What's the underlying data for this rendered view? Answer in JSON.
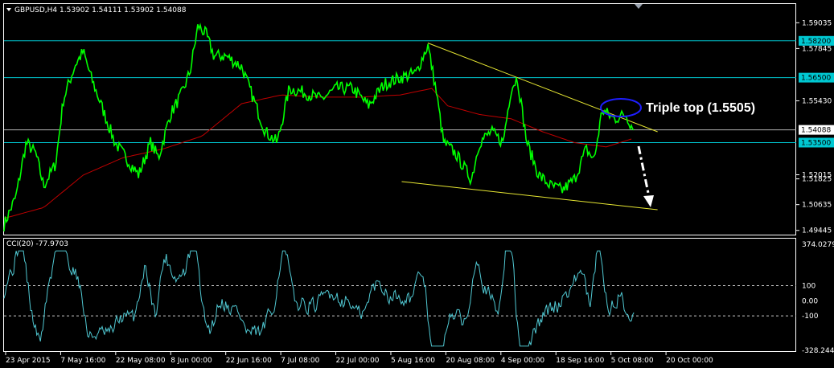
{
  "header": {
    "symbol_line": "GBPUSD,H4  1.53902 1.54111 1.53902 1.54088",
    "indicator_line": "CCI(20) -77.9703"
  },
  "colors": {
    "background": "#000000",
    "frame": "#ffffff",
    "price_line": "#00ff00",
    "moving_average": "#c00000",
    "levels": "#00c8d2",
    "trendlines": "#e6e632",
    "cci_line": "#50c8d2",
    "triple_top_marker": "#1e1eff",
    "forecast_arrow": "#ffffff"
  },
  "price_axis": {
    "labels": [
      "1.59035",
      "1.57845",
      "1.55430",
      "1.52015",
      "1.51825",
      "1.50635",
      "1.49445"
    ],
    "ticks": [
      1.59035,
      1.57845,
      1.5543,
      1.52015,
      1.51825,
      1.50635,
      1.49445
    ],
    "range": [
      1.4925,
      1.599
    ],
    "level_tags": [
      {
        "label": "1.58200",
        "value": 1.582
      },
      {
        "label": "1.56500",
        "value": 1.565
      },
      {
        "label": "1.54088",
        "value": 1.54088
      },
      {
        "label": "1.53500",
        "value": 1.535
      }
    ]
  },
  "cci_axis": {
    "labels": [
      "374.0279",
      "100",
      "0.00",
      "-100",
      "-328.2446"
    ],
    "values": [
      374.0279,
      100,
      0,
      -100,
      -328.2446
    ]
  },
  "time_axis": {
    "labels": [
      "23 Apr 2015",
      "7 May 16:00",
      "22 May 08:00",
      "8 Jun 00:00",
      "22 Jun 16:00",
      "7 Jul 08:00",
      "22 Jul 00:00",
      "5 Aug 16:00",
      "20 Aug 08:00",
      "4 Sep 00:00",
      "18 Sep 16:00",
      "5 Oct 08:00",
      "20 Oct 00:00"
    ]
  },
  "annotation": {
    "text": "Triple top (1.5505)",
    "value": 1.5505
  },
  "chart_data": {
    "type": "line",
    "x": [
      "23 Apr 2015",
      "7 May 16:00",
      "22 May 08:00",
      "8 Jun 00:00",
      "22 Jun 16:00",
      "7 Jul 08:00",
      "22 Jul 00:00",
      "5 Aug 16:00",
      "20 Aug 08:00",
      "4 Sep 00:00",
      "18 Sep 16:00",
      "5 Oct 08:00",
      "20 Oct 00:00"
    ],
    "price": {
      "knots": [
        [
          0,
          1.497
        ],
        [
          0.015,
          1.51
        ],
        [
          0.028,
          1.535
        ],
        [
          0.04,
          1.53
        ],
        [
          0.05,
          1.515
        ],
        [
          0.065,
          1.525
        ],
        [
          0.075,
          1.555
        ],
        [
          0.09,
          1.571
        ],
        [
          0.1,
          1.577
        ],
        [
          0.11,
          1.565
        ],
        [
          0.125,
          1.55
        ],
        [
          0.14,
          1.535
        ],
        [
          0.16,
          1.525
        ],
        [
          0.17,
          1.52
        ],
        [
          0.185,
          1.535
        ],
        [
          0.195,
          1.528
        ],
        [
          0.21,
          1.548
        ],
        [
          0.225,
          1.558
        ],
        [
          0.235,
          1.568
        ],
        [
          0.245,
          1.589
        ],
        [
          0.255,
          1.585
        ],
        [
          0.265,
          1.575
        ],
        [
          0.28,
          1.575
        ],
        [
          0.3,
          1.57
        ],
        [
          0.315,
          1.555
        ],
        [
          0.33,
          1.54
        ],
        [
          0.345,
          1.535
        ],
        [
          0.36,
          1.56
        ],
        [
          0.38,
          1.558
        ],
        [
          0.4,
          1.555
        ],
        [
          0.42,
          1.56
        ],
        [
          0.44,
          1.56
        ],
        [
          0.46,
          1.552
        ],
        [
          0.48,
          1.562
        ],
        [
          0.5,
          1.565
        ],
        [
          0.52,
          1.567
        ],
        [
          0.535,
          1.58
        ],
        [
          0.545,
          1.56
        ],
        [
          0.555,
          1.535
        ],
        [
          0.57,
          1.53
        ],
        [
          0.59,
          1.518
        ],
        [
          0.6,
          1.535
        ],
        [
          0.615,
          1.54
        ],
        [
          0.63,
          1.535
        ],
        [
          0.64,
          1.56
        ],
        [
          0.648,
          1.565
        ],
        [
          0.66,
          1.535
        ],
        [
          0.675,
          1.52
        ],
        [
          0.69,
          1.515
        ],
        [
          0.705,
          1.513
        ],
        [
          0.72,
          1.518
        ],
        [
          0.735,
          1.532
        ],
        [
          0.745,
          1.527
        ],
        [
          0.755,
          1.55
        ],
        [
          0.77,
          1.546
        ],
        [
          0.785,
          1.548
        ],
        [
          0.795,
          1.54088
        ]
      ],
      "last": 1.54088
    },
    "moving_average": {
      "knots": [
        [
          0,
          1.5
        ],
        [
          0.05,
          1.505
        ],
        [
          0.1,
          1.52
        ],
        [
          0.15,
          1.528
        ],
        [
          0.2,
          1.532
        ],
        [
          0.25,
          1.538
        ],
        [
          0.3,
          1.553
        ],
        [
          0.35,
          1.557
        ],
        [
          0.4,
          1.556
        ],
        [
          0.45,
          1.556
        ],
        [
          0.5,
          1.557
        ],
        [
          0.54,
          1.56
        ],
        [
          0.56,
          1.552
        ],
        [
          0.6,
          1.548
        ],
        [
          0.64,
          1.546
        ],
        [
          0.68,
          1.54
        ],
        [
          0.72,
          1.535
        ],
        [
          0.76,
          1.533
        ],
        [
          0.795,
          1.537
        ]
      ]
    },
    "levels": [
      1.582,
      1.565,
      1.54088,
      1.535
    ],
    "trendlines": [
      {
        "from": [
          0.535,
          1.581
        ],
        "to": [
          0.825,
          1.54
        ]
      },
      {
        "from": [
          0.502,
          1.517
        ],
        "to": [
          0.825,
          1.504
        ]
      }
    ],
    "cci": {
      "indicator": "CCI(20)",
      "last": -77.9703,
      "levels": [
        100,
        -100
      ],
      "range": [
        -328.2446,
        374.0279
      ]
    }
  }
}
